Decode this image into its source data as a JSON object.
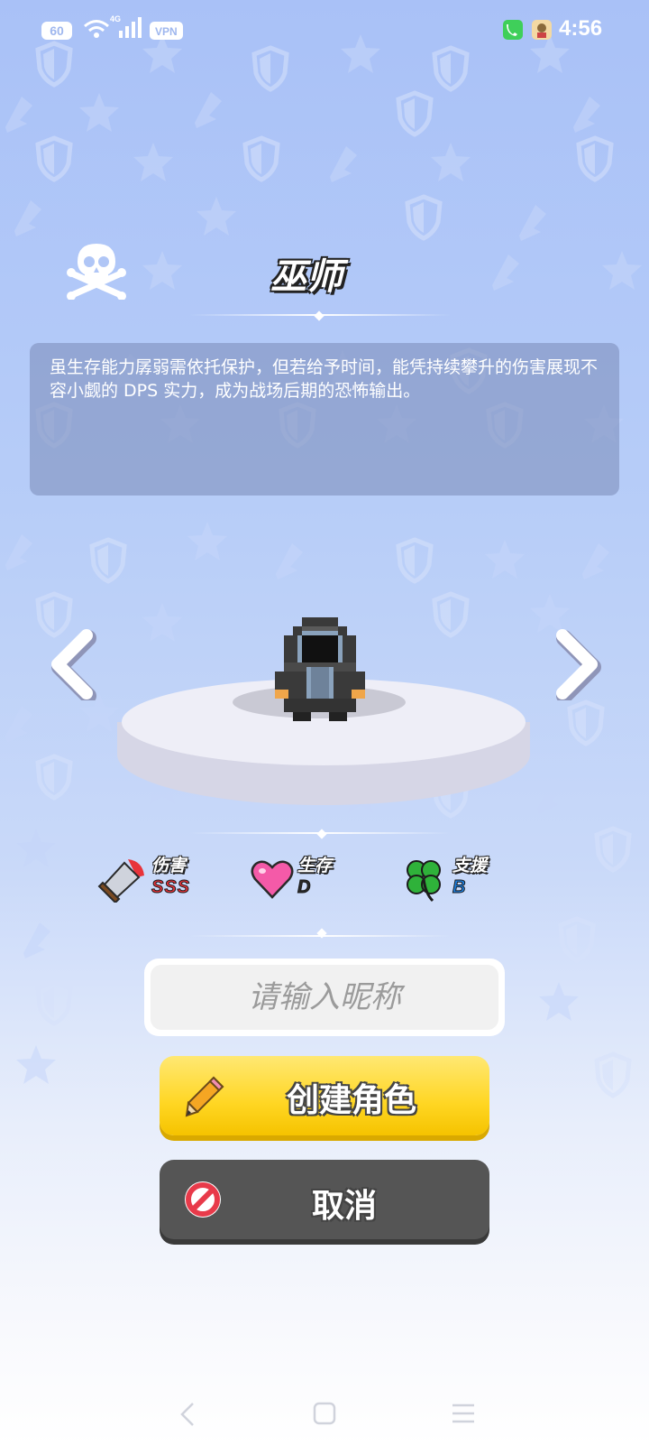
{
  "status_bar": {
    "refresh_rate": "60",
    "network": "4G",
    "vpn": "VPN",
    "time": "4:56"
  },
  "character": {
    "name": "巫师",
    "description": "虽生存能力孱弱需依托保护，但若给予时间，能凭持续攀升的伤害展现不容小觑的 DPS 实力，成为战场后期的恐怖输出。"
  },
  "stats": [
    {
      "label": "伤害",
      "grade": "SSS",
      "grade_color": "#e8333a",
      "icon": "sword-icon"
    },
    {
      "label": "生存",
      "grade": "D",
      "grade_color": "#2a2a2a",
      "icon": "heart-icon"
    },
    {
      "label": "支援",
      "grade": "B",
      "grade_color": "#1e7fe0",
      "icon": "clover-icon"
    }
  ],
  "nickname_input": {
    "placeholder": "请输入昵称",
    "value": ""
  },
  "buttons": {
    "create_label": "创建角色",
    "cancel_label": "取消"
  },
  "colors": {
    "background_top": "#a9c1f7",
    "create_button": "#ffd623",
    "cancel_button": "#555555"
  }
}
